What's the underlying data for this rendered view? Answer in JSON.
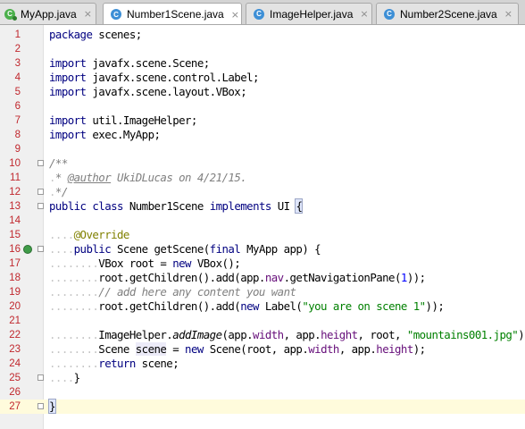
{
  "tabs": [
    {
      "label": "MyApp.java",
      "icon": "app-class-icon",
      "active": false
    },
    {
      "label": "Number1Scene.java",
      "icon": "class-icon",
      "active": true
    },
    {
      "label": "ImageHelper.java",
      "icon": "class-icon",
      "active": false
    },
    {
      "label": "Number2Scene.java",
      "icon": "class-icon",
      "active": false
    }
  ],
  "tab_close_glyph": "×",
  "class_icon_glyph": "C",
  "line_numbers": [
    "1",
    "2",
    "3",
    "4",
    "5",
    "6",
    "7",
    "8",
    "9",
    "10",
    "11",
    "12",
    "13",
    "14",
    "15",
    "16",
    "17",
    "18",
    "19",
    "20",
    "21",
    "22",
    "23",
    "24",
    "25",
    "26",
    "27"
  ],
  "code_lines": [
    "package scenes;",
    "",
    "import javafx.scene.Scene;",
    "import javafx.scene.control.Label;",
    "import javafx.scene.layout.VBox;",
    "",
    "import util.ImageHelper;",
    "import exec.MyApp;",
    "",
    "/**",
    " * @author UkiDLucas on 4/21/15.",
    " */",
    "public class Number1Scene implements UI {",
    "",
    "    @Override",
    "    public Scene getScene(final MyApp app) {",
    "        VBox root = new VBox();",
    "        root.getChildren().add(app.nav.getNavigationPane(1));",
    "        // add here any content you want",
    "        root.getChildren().add(new Label(\"you are on scene 1\"));",
    "",
    "        ImageHelper.addImage(app.width, app.height, root, \"mountains001.jpg\");",
    "        Scene scene = new Scene(root, app.width, app.height);",
    "        return scene;",
    "    }",
    "",
    "}"
  ],
  "colors": {
    "keyword": "#000080",
    "string": "#008000",
    "number": "#0000ff",
    "field": "#660e7a",
    "comment": "#808080",
    "annotation": "#808000",
    "line_number": "#c0272d",
    "current_line": "#fffbdc"
  }
}
